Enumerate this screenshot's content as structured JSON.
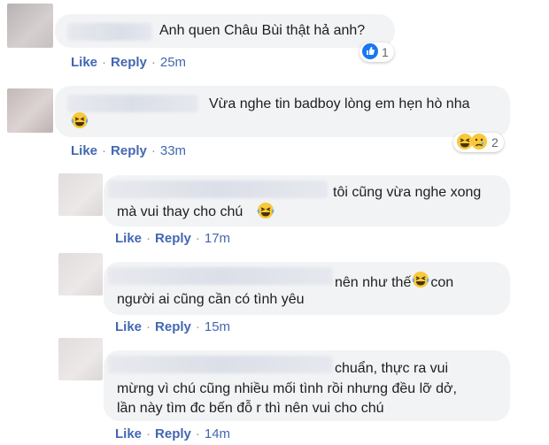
{
  "comments": [
    {
      "text_lines": [
        "Anh quen Châu Bùi thật hả anh?"
      ],
      "like": "Like",
      "reply": "Reply",
      "time": "25m",
      "reaction_count": "1"
    },
    {
      "text_lines": [
        "Vừa nghe tin badboy lòng em hẹn hò nha"
      ],
      "like": "Like",
      "reply": "Reply",
      "time": "33m",
      "reaction_count": "2"
    }
  ],
  "replies": [
    {
      "text_lines": [
        "tôi cũng vừa nghe xong",
        "mà vui thay cho chú"
      ],
      "like": "Like",
      "reply": "Reply",
      "time": "17m"
    },
    {
      "text_lines": [
        "nên như thế",
        "con",
        "người ai cũng cần có tình yêu"
      ],
      "like": "Like",
      "reply": "Reply",
      "time": "15m"
    },
    {
      "text_lines": [
        "chuẩn, thực ra vui",
        "mừng vì chú cũng nhiều mối tình rồi nhưng đều lỡ dở,",
        "lần này tìm đc bến đỗ r thì nên vui cho chú"
      ],
      "like": "Like",
      "reply": "Reply",
      "time": "14m"
    }
  ],
  "separator": "·",
  "colors": {
    "link": "#4267b2",
    "bubble": "#f2f3f5",
    "like_blue": "#1877f2",
    "emoji_yellow": "#f7c93b"
  },
  "icons": [
    "like-reaction-icon",
    "laughing-emoji-icon",
    "crying-emoji-icon"
  ]
}
